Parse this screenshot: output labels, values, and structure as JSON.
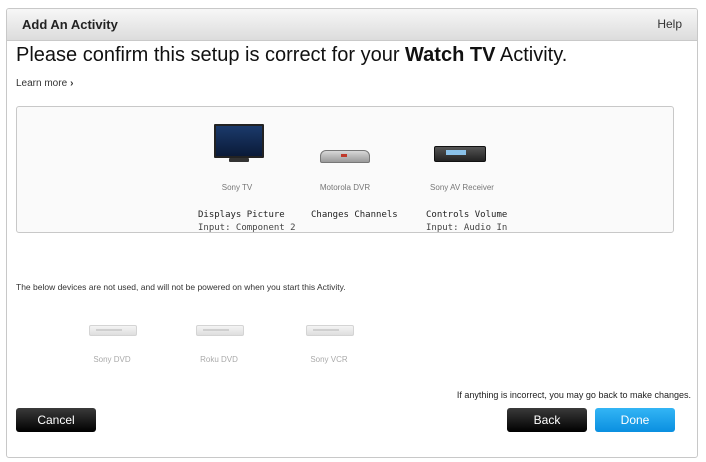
{
  "window": {
    "title": "Add An Activity",
    "help": "Help"
  },
  "heading": {
    "prefix": "Please confirm this setup is correct for your ",
    "activity": "Watch TV",
    "suffix": " Activity."
  },
  "learn_more": {
    "label": "Learn more",
    "chevron": "›"
  },
  "used_devices": [
    {
      "name": "Sony TV",
      "icon": "tv-icon",
      "role": "Displays Picture",
      "input": "Input: Component 2"
    },
    {
      "name": "Motorola DVR",
      "icon": "dvr-icon",
      "role": "Changes Channels",
      "input": ""
    },
    {
      "name": "Sony AV Receiver",
      "icon": "receiver-icon",
      "role": "Controls Volume",
      "input": "Input: Audio In"
    }
  ],
  "unused_note": "The below devices are not used, and will not be powered on when you start this Activity.",
  "unused_devices": [
    {
      "name": "Sony DVD",
      "icon": "dvd-player-icon"
    },
    {
      "name": "Roku DVD",
      "icon": "dvd-player-icon"
    },
    {
      "name": "Sony VCR",
      "icon": "vcr-icon"
    }
  ],
  "footnote": "If anything is incorrect, you may go back to make changes.",
  "buttons": {
    "cancel": "Cancel",
    "back": "Back",
    "done": "Done"
  },
  "colors": {
    "done": "#1a9fe8",
    "dark_button": "#111111"
  }
}
